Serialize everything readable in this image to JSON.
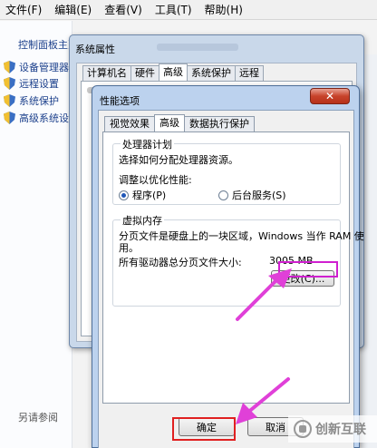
{
  "menubar": [
    "文件(F)",
    "编辑(E)",
    "查看(V)",
    "工具(T)",
    "帮助(H)"
  ],
  "control_panel": {
    "home": "控制面板主页",
    "links": [
      "设备管理器",
      "远程设置",
      "系统保护",
      "高级系统设置"
    ],
    "see_also": "另请参阅"
  },
  "system_properties": {
    "title": "系统属性",
    "tabs": [
      "计算机名",
      "硬件",
      "高级",
      "系统保护",
      "远程"
    ],
    "active_tab": "高级"
  },
  "performance_options": {
    "title": "性能选项",
    "close": "✕",
    "tabs": [
      "视觉效果",
      "高级",
      "数据执行保护"
    ],
    "scheduling": {
      "title": "处理器计划",
      "description": "选择如何分配处理器资源。",
      "adjust_label": "调整以优化性能:",
      "option_programs": "程序(P)",
      "option_services": "后台服务(S)",
      "selected": "程序(P)"
    },
    "virtual_memory": {
      "title": "虚拟内存",
      "description_line1": "分页文件是硬盘上的一块区域，Windows 当作 RAM 使",
      "description_line2": "用。",
      "total_label": "所有驱动器总分页文件大小:",
      "total_value": "3005 MB",
      "change_button": "更改(C)..."
    },
    "ok_button": "确定",
    "cancel_button": "取消"
  },
  "watermark": "创新互联",
  "colors": {
    "annotation_arrow": "#e040d8",
    "ok_highlight": "#e02020",
    "change_highlight": "#d020d0"
  }
}
